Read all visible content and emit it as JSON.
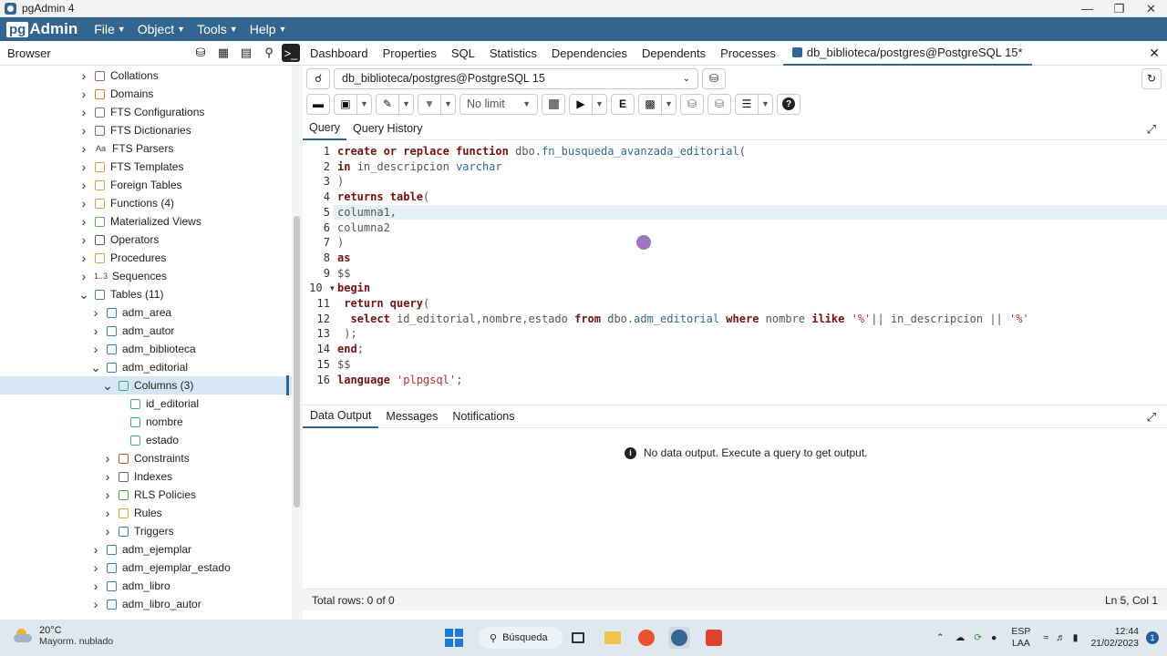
{
  "window": {
    "title": "pgAdmin 4",
    "minimize": "—",
    "maximize": "❐",
    "close": "✕"
  },
  "menubar": {
    "logo_pg": "pg",
    "logo_admin": "Admin",
    "items": [
      "File",
      "Object",
      "Tools",
      "Help"
    ]
  },
  "browser": {
    "header": "Browser"
  },
  "tree": [
    {
      "label": "Collations",
      "icon": "collation-icon",
      "color": "#b35a5a",
      "indent": 1,
      "expand": "collapsed"
    },
    {
      "label": "Domains",
      "icon": "domain-icon",
      "color": "#c7882b",
      "indent": 1,
      "expand": "collapsed"
    },
    {
      "label": "FTS Configurations",
      "icon": "fts-config-icon",
      "color": "#777",
      "indent": 1,
      "expand": "collapsed"
    },
    {
      "label": "FTS Dictionaries",
      "icon": "fts-dictionary-icon",
      "color": "#4a7ab0",
      "indent": 1,
      "expand": "collapsed"
    },
    {
      "label": "FTS Parsers",
      "icon": "fts-parser-icon",
      "color": "#444",
      "indent": 1,
      "expand": "collapsed",
      "glyph": "Aa"
    },
    {
      "label": "FTS Templates",
      "icon": "fts-template-icon",
      "color": "#d9a73a",
      "indent": 1,
      "expand": "collapsed"
    },
    {
      "label": "Foreign Tables",
      "icon": "foreign-table-icon",
      "color": "#d9a73a",
      "indent": 1,
      "expand": "collapsed"
    },
    {
      "label": "Functions (4)",
      "icon": "function-icon",
      "color": "#d9a73a",
      "indent": 1,
      "expand": "collapsed"
    },
    {
      "label": "Materialized Views",
      "icon": "materialized-view-icon",
      "color": "#69a84f",
      "indent": 1,
      "expand": "collapsed"
    },
    {
      "label": "Operators",
      "icon": "operator-icon",
      "color": "#555",
      "indent": 1,
      "expand": "collapsed"
    },
    {
      "label": "Procedures",
      "icon": "procedure-icon",
      "color": "#d9a73a",
      "indent": 1,
      "expand": "collapsed"
    },
    {
      "label": "Sequences",
      "icon": "sequence-icon",
      "color": "#444",
      "indent": 1,
      "expand": "collapsed",
      "glyph": "1..3"
    },
    {
      "label": "Tables (11)",
      "icon": "tables-icon",
      "color": "#3a7fb5",
      "indent": 1,
      "expand": "expanded"
    },
    {
      "label": "adm_area",
      "icon": "table-icon",
      "color": "#3a7fb5",
      "indent": 2,
      "expand": "collapsed"
    },
    {
      "label": "adm_autor",
      "icon": "table-icon",
      "color": "#3a7fb5",
      "indent": 2,
      "expand": "collapsed"
    },
    {
      "label": "adm_biblioteca",
      "icon": "table-icon",
      "color": "#3a7fb5",
      "indent": 2,
      "expand": "collapsed"
    },
    {
      "label": "adm_editorial",
      "icon": "table-icon",
      "color": "#3a7fb5",
      "indent": 2,
      "expand": "expanded"
    },
    {
      "label": "Columns (3)",
      "icon": "columns-icon",
      "color": "#3fae7a",
      "indent": 3,
      "expand": "expanded",
      "selected": true
    },
    {
      "label": "id_editorial",
      "icon": "column-icon",
      "color": "#3fae7a",
      "indent": 4,
      "expand": "none"
    },
    {
      "label": "nombre",
      "icon": "column-icon",
      "color": "#3fae7a",
      "indent": 4,
      "expand": "none"
    },
    {
      "label": "estado",
      "icon": "column-icon",
      "color": "#3fae7a",
      "indent": 4,
      "expand": "none"
    },
    {
      "label": "Constraints",
      "icon": "constraint-icon",
      "color": "#c0532d",
      "indent": 3,
      "expand": "collapsed"
    },
    {
      "label": "Indexes",
      "icon": "index-icon",
      "color": "#666",
      "indent": 3,
      "expand": "collapsed"
    },
    {
      "label": "RLS Policies",
      "icon": "rls-policy-icon",
      "color": "#5aa83a",
      "indent": 3,
      "expand": "collapsed"
    },
    {
      "label": "Rules",
      "icon": "rule-icon",
      "color": "#d9a73a",
      "indent": 3,
      "expand": "collapsed"
    },
    {
      "label": "Triggers",
      "icon": "trigger-icon",
      "color": "#3a7fb5",
      "indent": 3,
      "expand": "collapsed"
    },
    {
      "label": "adm_ejemplar",
      "icon": "table-icon",
      "color": "#3a7fb5",
      "indent": 2,
      "expand": "collapsed"
    },
    {
      "label": "adm_ejemplar_estado",
      "icon": "table-icon",
      "color": "#3a7fb5",
      "indent": 2,
      "expand": "collapsed"
    },
    {
      "label": "adm_libro",
      "icon": "table-icon",
      "color": "#3a7fb5",
      "indent": 2,
      "expand": "collapsed"
    },
    {
      "label": "adm_libro_autor",
      "icon": "table-icon",
      "color": "#3a7fb5",
      "indent": 2,
      "expand": "collapsed"
    }
  ],
  "tabs": [
    "Dashboard",
    "Properties",
    "SQL",
    "Statistics",
    "Dependencies",
    "Dependents",
    "Processes"
  ],
  "active_tab": "db_biblioteca/postgres@PostgreSQL 15*",
  "connection": "db_biblioteca/postgres@PostgreSQL 15",
  "toolbar": {
    "limit": "No limit"
  },
  "query_tabs": [
    "Query",
    "Query History"
  ],
  "code": [
    [
      [
        "kw",
        "create or replace function "
      ],
      [
        "op",
        "dbo."
      ],
      [
        "fn",
        "fn_busqueda_avanzada_editorial"
      ],
      [
        "op",
        "("
      ]
    ],
    [
      [
        "kw",
        "in "
      ],
      [
        "op",
        "in_descripcion "
      ],
      [
        "fn",
        "varchar"
      ]
    ],
    [
      [
        "op",
        ")"
      ]
    ],
    [
      [
        "kw",
        "returns table"
      ],
      [
        "op",
        "("
      ]
    ],
    [
      [
        "op",
        "columna1,"
      ]
    ],
    [
      [
        "op",
        "columna2"
      ]
    ],
    [
      [
        "op",
        ")"
      ]
    ],
    [
      [
        "kw",
        "as"
      ]
    ],
    [
      [
        "op",
        "$$"
      ]
    ],
    [
      [
        "kw",
        "begin"
      ]
    ],
    [
      [
        "op",
        " "
      ],
      [
        "kw",
        "return query"
      ],
      [
        "op",
        "("
      ]
    ],
    [
      [
        "op",
        "  "
      ],
      [
        "kw",
        "select "
      ],
      [
        "op",
        "id_editorial,nombre,estado "
      ],
      [
        "kw",
        "from "
      ],
      [
        "op",
        "dbo."
      ],
      [
        "fn",
        "adm_editorial "
      ],
      [
        "kw",
        "where "
      ],
      [
        "op",
        "nombre "
      ],
      [
        "kw",
        "ilike "
      ],
      [
        "st",
        "'%'"
      ],
      [
        "op",
        "|| in_descripcion || "
      ],
      [
        "st",
        "'%'"
      ]
    ],
    [
      [
        "op",
        " );"
      ]
    ],
    [
      [
        "kw",
        "end"
      ],
      [
        "op",
        ";"
      ]
    ],
    [
      [
        "op",
        "$$"
      ]
    ],
    [
      [
        "kw",
        "language "
      ],
      [
        "st",
        "'plpgsql'"
      ],
      [
        "op",
        ";"
      ]
    ]
  ],
  "result_tabs": [
    "Data Output",
    "Messages",
    "Notifications"
  ],
  "no_data": "No data output. Execute a query to get output.",
  "status": {
    "rows": "Total rows: 0 of 0",
    "position": "Ln 5, Col 1"
  },
  "taskbar": {
    "temp": "20°C",
    "weather": "Mayorm. nublado",
    "search": "Búsqueda",
    "lang1": "ESP",
    "lang2": "LAA",
    "time": "12:44",
    "date": "21/02/2023",
    "notif": "1"
  }
}
